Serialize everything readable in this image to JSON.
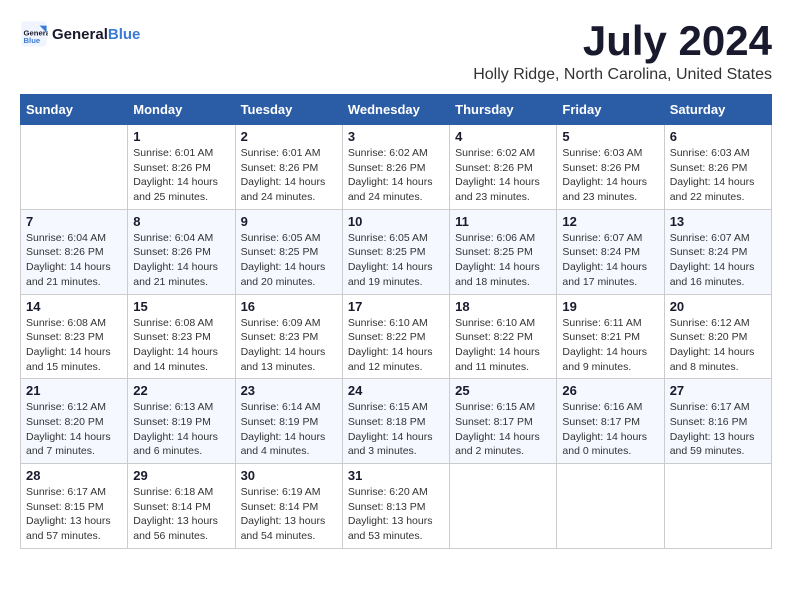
{
  "logo": {
    "line1": "General",
    "line2": "Blue"
  },
  "title": "July 2024",
  "location": "Holly Ridge, North Carolina, United States",
  "weekdays": [
    "Sunday",
    "Monday",
    "Tuesday",
    "Wednesday",
    "Thursday",
    "Friday",
    "Saturday"
  ],
  "weeks": [
    [
      {
        "day": "",
        "info": ""
      },
      {
        "day": "1",
        "info": "Sunrise: 6:01 AM\nSunset: 8:26 PM\nDaylight: 14 hours\nand 25 minutes."
      },
      {
        "day": "2",
        "info": "Sunrise: 6:01 AM\nSunset: 8:26 PM\nDaylight: 14 hours\nand 24 minutes."
      },
      {
        "day": "3",
        "info": "Sunrise: 6:02 AM\nSunset: 8:26 PM\nDaylight: 14 hours\nand 24 minutes."
      },
      {
        "day": "4",
        "info": "Sunrise: 6:02 AM\nSunset: 8:26 PM\nDaylight: 14 hours\nand 23 minutes."
      },
      {
        "day": "5",
        "info": "Sunrise: 6:03 AM\nSunset: 8:26 PM\nDaylight: 14 hours\nand 23 minutes."
      },
      {
        "day": "6",
        "info": "Sunrise: 6:03 AM\nSunset: 8:26 PM\nDaylight: 14 hours\nand 22 minutes."
      }
    ],
    [
      {
        "day": "7",
        "info": "Sunrise: 6:04 AM\nSunset: 8:26 PM\nDaylight: 14 hours\nand 21 minutes."
      },
      {
        "day": "8",
        "info": "Sunrise: 6:04 AM\nSunset: 8:26 PM\nDaylight: 14 hours\nand 21 minutes."
      },
      {
        "day": "9",
        "info": "Sunrise: 6:05 AM\nSunset: 8:25 PM\nDaylight: 14 hours\nand 20 minutes."
      },
      {
        "day": "10",
        "info": "Sunrise: 6:05 AM\nSunset: 8:25 PM\nDaylight: 14 hours\nand 19 minutes."
      },
      {
        "day": "11",
        "info": "Sunrise: 6:06 AM\nSunset: 8:25 PM\nDaylight: 14 hours\nand 18 minutes."
      },
      {
        "day": "12",
        "info": "Sunrise: 6:07 AM\nSunset: 8:24 PM\nDaylight: 14 hours\nand 17 minutes."
      },
      {
        "day": "13",
        "info": "Sunrise: 6:07 AM\nSunset: 8:24 PM\nDaylight: 14 hours\nand 16 minutes."
      }
    ],
    [
      {
        "day": "14",
        "info": "Sunrise: 6:08 AM\nSunset: 8:23 PM\nDaylight: 14 hours\nand 15 minutes."
      },
      {
        "day": "15",
        "info": "Sunrise: 6:08 AM\nSunset: 8:23 PM\nDaylight: 14 hours\nand 14 minutes."
      },
      {
        "day": "16",
        "info": "Sunrise: 6:09 AM\nSunset: 8:23 PM\nDaylight: 14 hours\nand 13 minutes."
      },
      {
        "day": "17",
        "info": "Sunrise: 6:10 AM\nSunset: 8:22 PM\nDaylight: 14 hours\nand 12 minutes."
      },
      {
        "day": "18",
        "info": "Sunrise: 6:10 AM\nSunset: 8:22 PM\nDaylight: 14 hours\nand 11 minutes."
      },
      {
        "day": "19",
        "info": "Sunrise: 6:11 AM\nSunset: 8:21 PM\nDaylight: 14 hours\nand 9 minutes."
      },
      {
        "day": "20",
        "info": "Sunrise: 6:12 AM\nSunset: 8:20 PM\nDaylight: 14 hours\nand 8 minutes."
      }
    ],
    [
      {
        "day": "21",
        "info": "Sunrise: 6:12 AM\nSunset: 8:20 PM\nDaylight: 14 hours\nand 7 minutes."
      },
      {
        "day": "22",
        "info": "Sunrise: 6:13 AM\nSunset: 8:19 PM\nDaylight: 14 hours\nand 6 minutes."
      },
      {
        "day": "23",
        "info": "Sunrise: 6:14 AM\nSunset: 8:19 PM\nDaylight: 14 hours\nand 4 minutes."
      },
      {
        "day": "24",
        "info": "Sunrise: 6:15 AM\nSunset: 8:18 PM\nDaylight: 14 hours\nand 3 minutes."
      },
      {
        "day": "25",
        "info": "Sunrise: 6:15 AM\nSunset: 8:17 PM\nDaylight: 14 hours\nand 2 minutes."
      },
      {
        "day": "26",
        "info": "Sunrise: 6:16 AM\nSunset: 8:17 PM\nDaylight: 14 hours\nand 0 minutes."
      },
      {
        "day": "27",
        "info": "Sunrise: 6:17 AM\nSunset: 8:16 PM\nDaylight: 13 hours\nand 59 minutes."
      }
    ],
    [
      {
        "day": "28",
        "info": "Sunrise: 6:17 AM\nSunset: 8:15 PM\nDaylight: 13 hours\nand 57 minutes."
      },
      {
        "day": "29",
        "info": "Sunrise: 6:18 AM\nSunset: 8:14 PM\nDaylight: 13 hours\nand 56 minutes."
      },
      {
        "day": "30",
        "info": "Sunrise: 6:19 AM\nSunset: 8:14 PM\nDaylight: 13 hours\nand 54 minutes."
      },
      {
        "day": "31",
        "info": "Sunrise: 6:20 AM\nSunset: 8:13 PM\nDaylight: 13 hours\nand 53 minutes."
      },
      {
        "day": "",
        "info": ""
      },
      {
        "day": "",
        "info": ""
      },
      {
        "day": "",
        "info": ""
      }
    ]
  ]
}
